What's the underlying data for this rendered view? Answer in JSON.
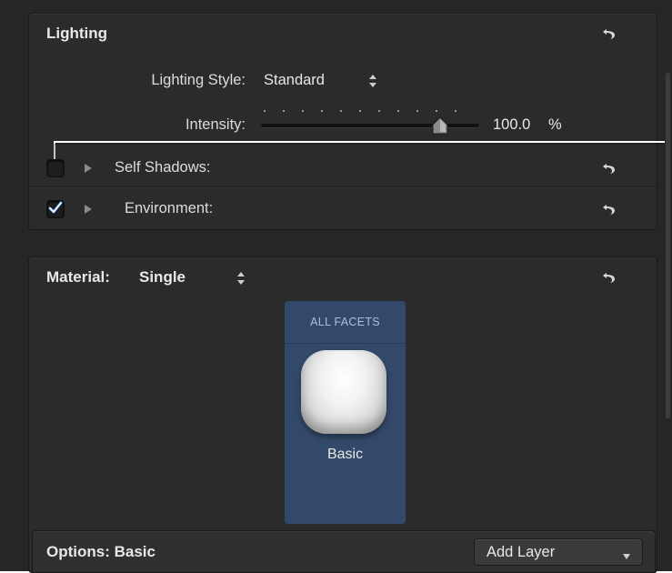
{
  "lighting": {
    "title": "Lighting",
    "style_label": "Lighting Style:",
    "style_value": "Standard",
    "intensity_label": "Intensity:",
    "intensity_value": "100.0",
    "intensity_unit": "%",
    "intensity_fraction": 1.0,
    "self_shadows": {
      "label": "Self Shadows:",
      "checked": false
    },
    "environment": {
      "label": "Environment:",
      "checked": true
    }
  },
  "material": {
    "label": "Material:",
    "value": "Single",
    "facet_header": "ALL FACETS",
    "facet_name": "Basic"
  },
  "options": {
    "label": "Options: Basic",
    "add_layer_label": "Add Layer"
  },
  "colors": {
    "panel_bg": "#2b2b2b",
    "facet_tile": "#33496a",
    "facet_header_text": "#a6c0e4",
    "check_mark": "#5aa0ff"
  },
  "icons": {
    "reset": "reset-arrow-icon",
    "stepper": "up-down-stepper-icon",
    "disclosure": "disclosure-triangle-icon",
    "dropdown": "chevron-down-icon"
  }
}
